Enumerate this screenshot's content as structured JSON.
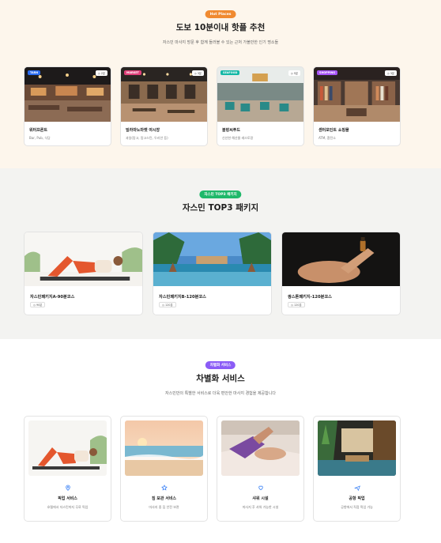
{
  "colors": {
    "hot_bg": "#fdf6ec",
    "pkg_bg": "#f3f3f1",
    "hot_pill": "#f08a30",
    "pkg_pill": "#1fb86a",
    "svc_pill": "#8b5cf6",
    "svc_icon": "#3b82f6"
  },
  "hot_places": {
    "pill": "Hot Places",
    "title": "도보 10분이내 핫플 추천",
    "subtitle": "자스민 마사지 방문 후 함께 들러볼 수 있는 근처 가볼만한 인기 명소들",
    "items": [
      {
        "tag": "TARN",
        "tag_color": "#2b6cf0",
        "distance": "2분",
        "name": "워터프론트",
        "desc": "Bar, Pub, 식당"
      },
      {
        "tag": "MARKET",
        "tag_color": "#e0407a",
        "distance": "3분",
        "name": "빌라마노마켓 야시장",
        "desc": "과일(망고, 망고스틴, 두리안 등)"
      },
      {
        "tag": "SEAFOOD",
        "tag_color": "#14b8a6",
        "distance": "5분",
        "name": "블랑씨푸드",
        "desc": "신선한 해산물 레스토랑"
      },
      {
        "tag": "SHOPPING",
        "tag_color": "#a855f7",
        "distance": "3분",
        "name": "센터포인트 쇼핑몰",
        "desc": "ATM, 환전소"
      }
    ]
  },
  "packages": {
    "pill": "자스민 TOP3 패키지",
    "title": "자스민 TOP3 패키지",
    "items": [
      {
        "name": "자스민패키지A-90분코스",
        "duration": "90분"
      },
      {
        "name": "자스민패키지B-120분코스",
        "duration": "120분"
      },
      {
        "name": "쌍스톤패키지-120분코스",
        "duration": "120분"
      }
    ]
  },
  "services": {
    "pill": "차별화 서비스",
    "title": "차별화 서비스",
    "subtitle": "자스민만의 특별한 서비스로 더욱 편안한 마사지 경험을 제공합니다",
    "items": [
      {
        "icon": "location-pin-icon",
        "name": "픽업 서비스",
        "desc": "호텔에서 자스민까지 무료 픽업"
      },
      {
        "icon": "star-icon",
        "name": "짐 보관 서비스",
        "desc": "마사지 중 짐 안전 보관"
      },
      {
        "icon": "heart-icon",
        "name": "샤워 시설",
        "desc": "마사지 후 샤워 가능한 시설"
      },
      {
        "icon": "plane-icon",
        "name": "공항 픽업",
        "desc": "공항에서 직접 픽업 가능"
      }
    ]
  }
}
